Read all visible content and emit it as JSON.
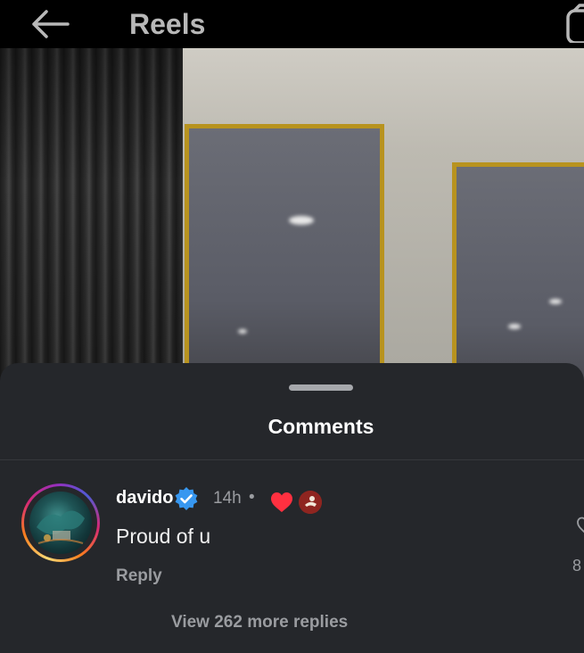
{
  "header": {
    "title": "Reels",
    "back_icon": "back-arrow-icon",
    "camera_icon": "camera-icon"
  },
  "sheet": {
    "title": "Comments"
  },
  "comment": {
    "username": "davido",
    "verified": true,
    "time": "14h",
    "separator": "•",
    "text": "Proud of u",
    "reply_label": "Reply",
    "like_count": "8",
    "view_replies_label": "View 262 more replies"
  },
  "colors": {
    "sheet_bg": "#25272b",
    "verified_blue": "#3797f0",
    "heart_red": "#ff3040",
    "muted_text": "#9a9ca0"
  }
}
